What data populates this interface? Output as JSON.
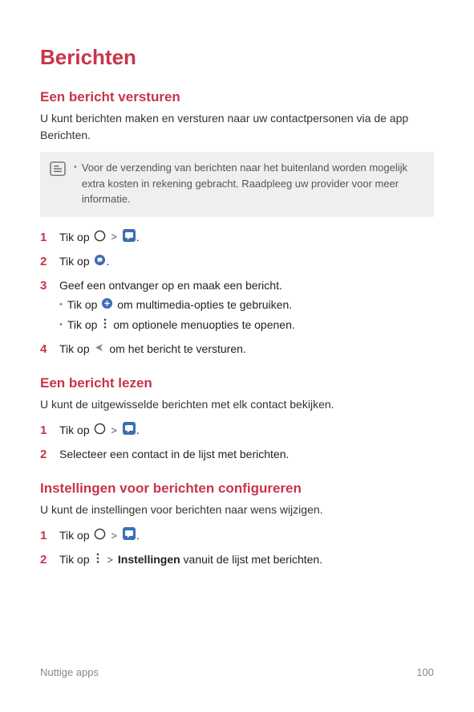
{
  "title": "Berichten",
  "section1": {
    "heading": "Een bericht versturen",
    "intro": "U kunt berichten maken en versturen naar uw contactpersonen via de app Berichten.",
    "note": "Voor de verzending van berichten naar het buitenland worden mogelijk extra kosten in rekening gebracht. Raadpleeg uw provider voor meer informatie.",
    "step1_pre": "Tik op",
    "step2_pre": "Tik op",
    "step3": "Geef een ontvanger op en maak een bericht.",
    "step3_sub1_pre": "Tik op",
    "step3_sub1_post": "om multimedia-opties te gebruiken.",
    "step3_sub2_pre": "Tik op",
    "step3_sub2_post": "om optionele menuopties te openen.",
    "step4_pre": "Tik op",
    "step4_post": "om het bericht te versturen."
  },
  "section2": {
    "heading": "Een bericht lezen",
    "intro": "U kunt de uitgewisselde berichten met elk contact bekijken.",
    "step1_pre": "Tik op",
    "step2": "Selecteer een contact in de lijst met berichten."
  },
  "section3": {
    "heading": "Instellingen voor berichten configureren",
    "intro": "U kunt de instellingen voor berichten naar wens wijzigen.",
    "step1_pre": "Tik op",
    "step2_pre": "Tik op",
    "step2_bold": "Instellingen",
    "step2_post": " vanuit de lijst met berichten."
  },
  "footer": {
    "section": "Nuttige apps",
    "page": "100"
  },
  "chevron": ">",
  "period": "."
}
